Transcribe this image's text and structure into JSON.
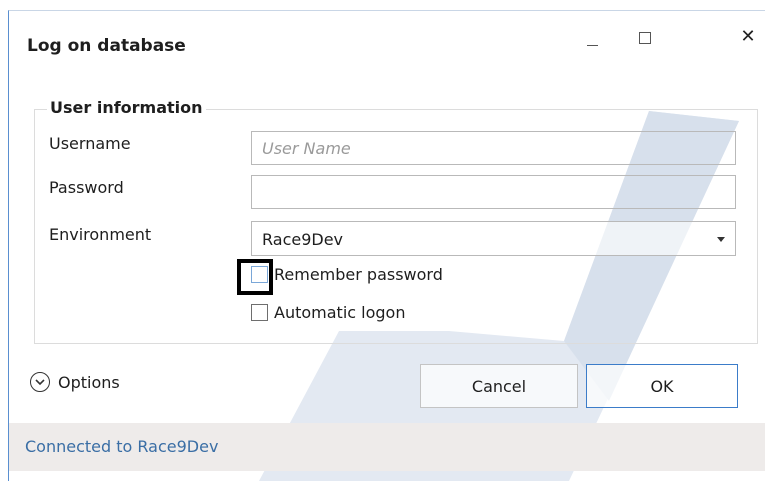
{
  "window": {
    "title": "Log on database"
  },
  "user_info": {
    "legend": "User information",
    "username_label": "Username",
    "username_value": "",
    "username_placeholder": "User Name",
    "password_label": "Password",
    "password_value": "",
    "environment_label": "Environment",
    "environment_value": "Race9Dev",
    "remember_label": "Remember password",
    "remember_checked": false,
    "auto_logon_label": "Automatic logon",
    "auto_logon_checked": false
  },
  "footer": {
    "options_label": "Options",
    "cancel_label": "Cancel",
    "ok_label": "OK"
  },
  "status": {
    "text": "Connected to Race9Dev"
  },
  "colors": {
    "accent": "#3b7cc9",
    "status_text": "#3a6ea5",
    "status_bg": "#eeebea",
    "watermark": "#dce4ef"
  },
  "icons": {
    "minimize": "minimize-icon",
    "maximize": "maximize-icon",
    "close": "close-icon",
    "options": "chevron-down-circle-icon",
    "dropdown": "dropdown-arrow-icon"
  }
}
